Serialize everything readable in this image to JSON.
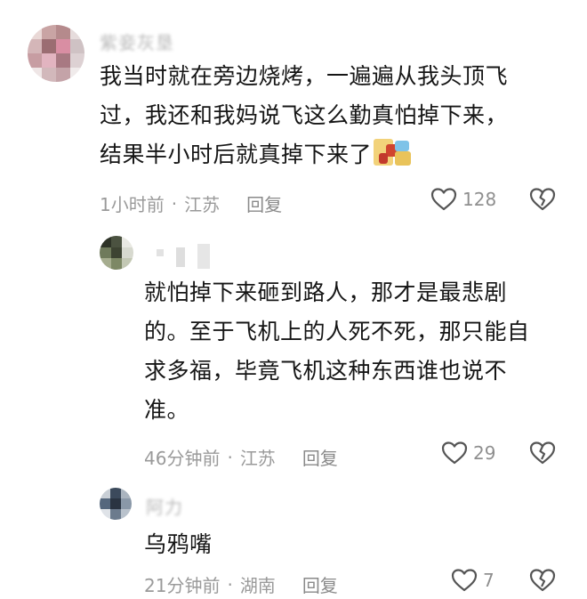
{
  "comments": [
    {
      "username": "紫妾灰垦",
      "body_lines": [
        "我当时就在旁边烧烤，一遍遍从我头顶飞",
        "过，我还和我妈说飞这么勤真怕掉下来，",
        "结果半小时后就真掉下来了"
      ],
      "time": "1小时前",
      "location": "江苏",
      "reply_label": "回复",
      "likes": "128",
      "has_sticker": true
    },
    {
      "username": "",
      "body_lines": [
        "就怕掉下来砸到路人，那才是最悲剧",
        "的。至于飞机上的人死不死，那只能自",
        "求多福，毕竟飞机这种东西谁也说不",
        "准。"
      ],
      "time": "46分钟前",
      "location": "江苏",
      "reply_label": "回复",
      "likes": "29"
    },
    {
      "username": "阿力",
      "body_lines": [
        "乌鸦嘴"
      ],
      "time": "21分钟前",
      "location": "湖南",
      "reply_label": "回复",
      "likes": "7"
    }
  ],
  "separator": "·",
  "colors": {
    "meta_text": "#9a9a9a",
    "icon_stroke": "#555555",
    "body_text": "#161616"
  },
  "icons": [
    "heart-outline-icon",
    "broken-heart-icon"
  ]
}
